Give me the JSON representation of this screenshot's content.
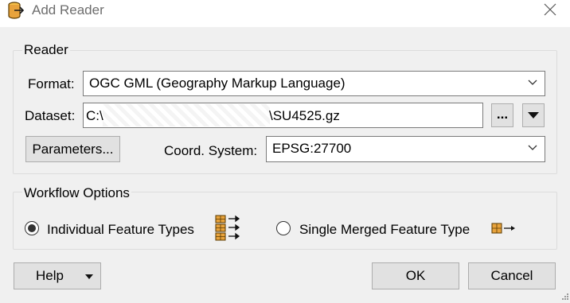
{
  "window": {
    "title": "Add Reader"
  },
  "reader": {
    "group_label": "Reader",
    "format_label": "Format:",
    "format_value": "OGC GML (Geography Markup Language)",
    "dataset_label": "Dataset:",
    "dataset_prefix": "C:\\",
    "dataset_suffix": "\\SU4525.gz",
    "browse_label": "...",
    "parameters_label": "Parameters...",
    "coord_label": "Coord. System:",
    "coord_value": "EPSG:27700"
  },
  "workflow": {
    "group_label": "Workflow Options",
    "option1_label": "Individual Feature Types",
    "option2_label": "Single Merged Feature Type",
    "selected": "Individual Feature Types"
  },
  "footer": {
    "help_label": "Help",
    "ok_label": "OK",
    "cancel_label": "Cancel"
  },
  "colors": {
    "icon_orange": "#e8a33c",
    "icon_dark": "#5a3a00"
  }
}
